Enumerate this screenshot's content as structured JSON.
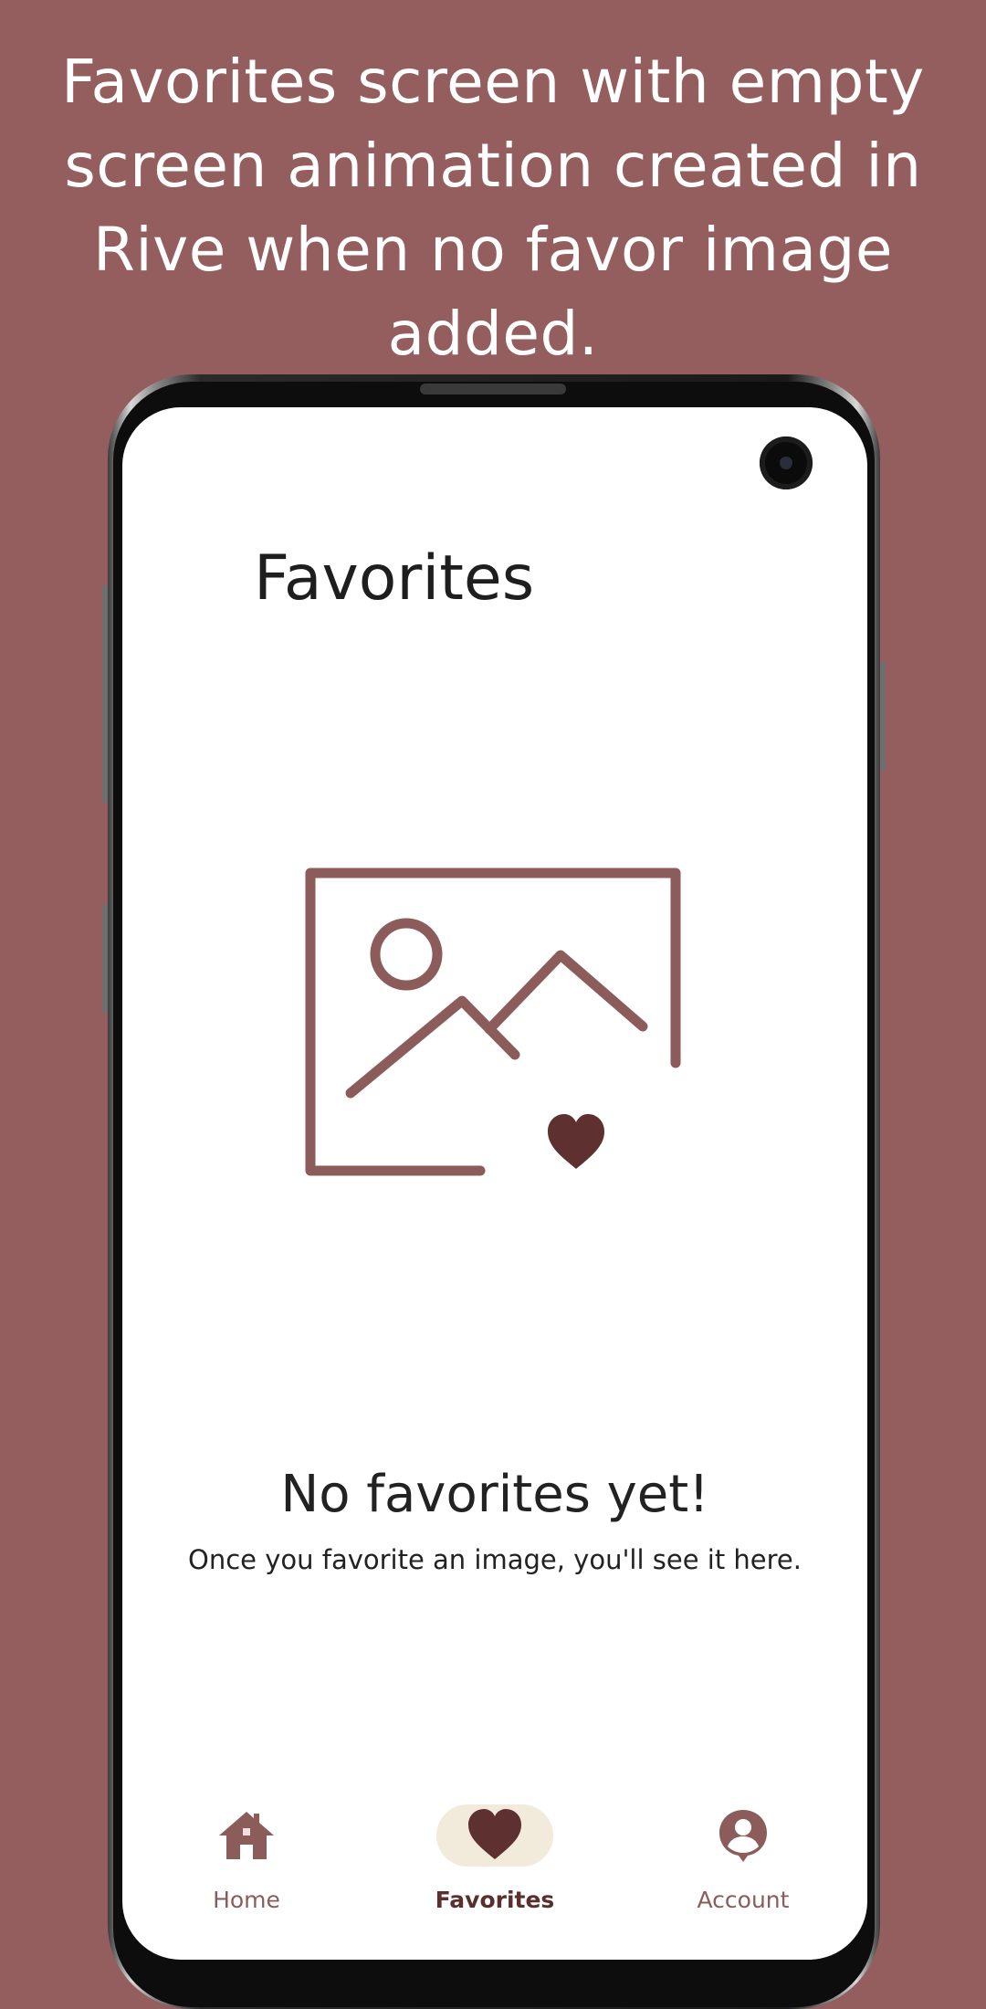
{
  "caption": "Favorites screen with empty screen animation created in Rive when no favor image added.",
  "colors": {
    "background": "#935e5d",
    "accent": "#8c5c5b",
    "heart": "#5e3030",
    "nav_pill": "#f2eadb"
  },
  "screen": {
    "title": "Favorites",
    "empty_state": {
      "illustration_icon": "image-heart-icon",
      "title": "No favorites yet!",
      "subtitle": "Once you favorite an image, you'll see it here."
    }
  },
  "bottom_nav": {
    "items": [
      {
        "label": "Home",
        "icon": "home-icon",
        "active": false
      },
      {
        "label": "Favorites",
        "icon": "heart-icon",
        "active": true
      },
      {
        "label": "Account",
        "icon": "account-icon",
        "active": false
      }
    ]
  }
}
